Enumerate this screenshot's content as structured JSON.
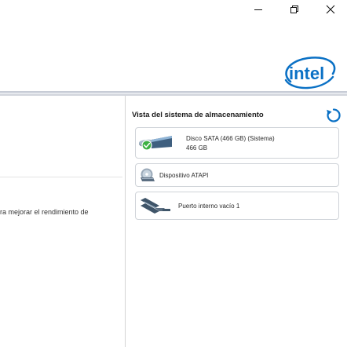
{
  "window_controls": {
    "minimize_icon": "minimize-icon",
    "maximize_icon": "restore-icon",
    "close_icon": "close-icon"
  },
  "logo": {
    "text": "intel",
    "color": "#0b71c5"
  },
  "left_panel": {
    "description_fragment": "ra mejorar el rendimiento de"
  },
  "storage_view": {
    "title": "Vista del sistema de almacenamiento",
    "refresh_icon": "refresh-icon",
    "devices": [
      {
        "icon": "sata-disk-icon",
        "name": "Disco SATA (466 GB) (Sistema)",
        "size": "466 GB",
        "status": "ok"
      },
      {
        "icon": "optical-drive-icon",
        "name": "Dispositivo ATAPI"
      },
      {
        "icon": "empty-port-icon",
        "name": "Puerto interno vacío 1"
      }
    ]
  },
  "colors": {
    "accent": "#0b71c5",
    "status_ok": "#3cb043",
    "card_border": "#cfd3d8"
  }
}
